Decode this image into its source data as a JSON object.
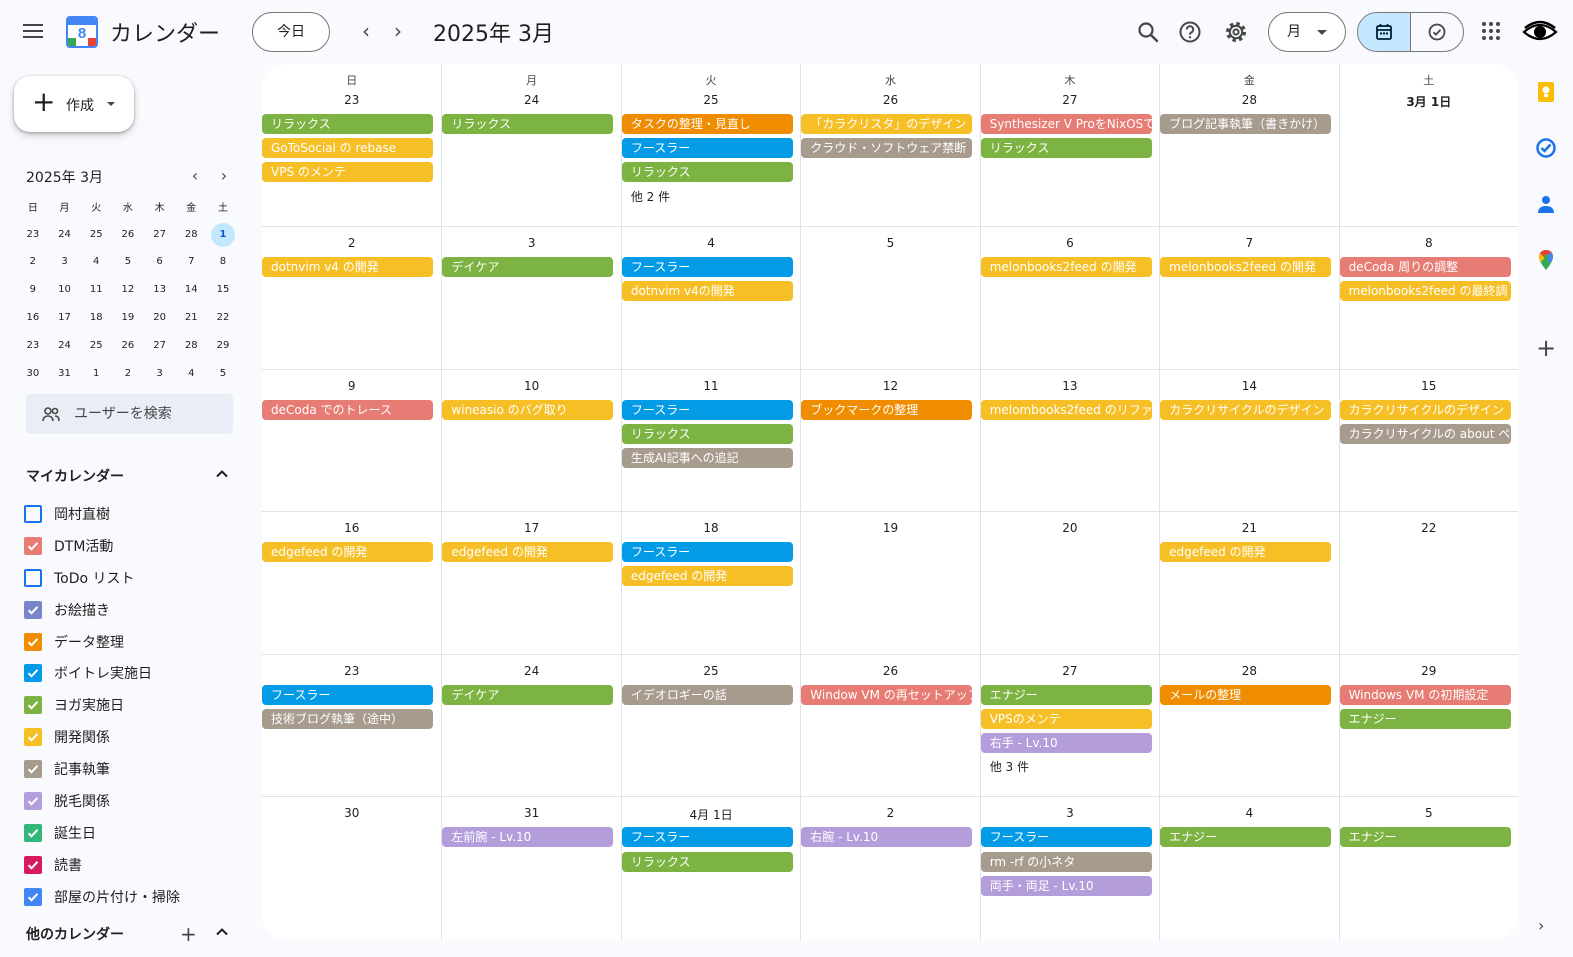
{
  "app": {
    "title": "カレンダー",
    "logo_number": "8"
  },
  "header": {
    "today_label": "今日",
    "month_title": "2025年 3月",
    "view_label": "月"
  },
  "sidebar": {
    "create_label": "作成",
    "mini_title": "2025年 3月",
    "mini_weekdays": [
      "日",
      "月",
      "火",
      "水",
      "木",
      "金",
      "土"
    ],
    "mini_weeks": [
      [
        "23",
        "24",
        "25",
        "26",
        "27",
        "28",
        "1"
      ],
      [
        "2",
        "3",
        "4",
        "5",
        "6",
        "7",
        "8"
      ],
      [
        "9",
        "10",
        "11",
        "12",
        "13",
        "14",
        "15"
      ],
      [
        "16",
        "17",
        "18",
        "19",
        "20",
        "21",
        "22"
      ],
      [
        "23",
        "24",
        "25",
        "26",
        "27",
        "28",
        "29"
      ],
      [
        "30",
        "31",
        "1",
        "2",
        "3",
        "4",
        "5"
      ]
    ],
    "mini_today": "1",
    "search_users": "ユーザーを検索",
    "my_calendars_title": "マイカレンダー",
    "my_calendars": [
      {
        "label": "岡村直樹",
        "color": "#1a73e8",
        "checked": false
      },
      {
        "label": "DTM活動",
        "color": "#e67c73",
        "checked": true
      },
      {
        "label": "ToDo リスト",
        "color": "#1a73e8",
        "checked": false
      },
      {
        "label": "お絵描き",
        "color": "#7986cb",
        "checked": true
      },
      {
        "label": "データ整理",
        "color": "#ef8c00",
        "checked": true
      },
      {
        "label": "ボイトレ実施日",
        "color": "#039be5",
        "checked": true
      },
      {
        "label": "ヨガ実施日",
        "color": "#7cb342",
        "checked": true
      },
      {
        "label": "開発関係",
        "color": "#f6bf26",
        "checked": true
      },
      {
        "label": "記事執筆",
        "color": "#a79b8e",
        "checked": true
      },
      {
        "label": "脱毛関係",
        "color": "#b39ddb",
        "checked": true
      },
      {
        "label": "誕生日",
        "color": "#33b679",
        "checked": true
      },
      {
        "label": "読書",
        "color": "#d81b60",
        "checked": true
      },
      {
        "label": "部屋の片付け・掃除",
        "color": "#4285f4",
        "checked": true
      }
    ],
    "other_calendars_title": "他のカレンダー"
  },
  "colors": {
    "green": "#7cb342",
    "yellow": "#f6bf26",
    "orange": "#ef8c00",
    "blue": "#039be5",
    "taupe": "#a79b8e",
    "flamingo": "#e67c73",
    "lavender": "#b39ddb"
  },
  "weekdays": [
    "日",
    "月",
    "火",
    "水",
    "木",
    "金",
    "土"
  ],
  "weeks": [
    [
      {
        "date": "23",
        "events": [
          {
            "t": "リラックス",
            "c": "green"
          },
          {
            "t": "GoToSocial の rebase",
            "c": "yellow"
          },
          {
            "t": "VPS のメンテ",
            "c": "yellow"
          }
        ]
      },
      {
        "date": "24",
        "events": [
          {
            "t": "リラックス",
            "c": "green"
          }
        ]
      },
      {
        "date": "25",
        "events": [
          {
            "t": "タスクの整理・見直し",
            "c": "orange"
          },
          {
            "t": "フースラー",
            "c": "blue"
          },
          {
            "t": "リラックス",
            "c": "green"
          }
        ],
        "more": "他 2 件"
      },
      {
        "date": "26",
        "events": [
          {
            "t": "「カラクリスタ」のデザイン",
            "c": "yellow"
          },
          {
            "t": "クラウド・ソフトウェア禁断",
            "c": "taupe"
          }
        ]
      },
      {
        "date": "27",
        "events": [
          {
            "t": "Synthesizer V ProをNixOSで",
            "c": "flamingo"
          },
          {
            "t": "リラックス",
            "c": "green"
          }
        ]
      },
      {
        "date": "28",
        "events": [
          {
            "t": "ブログ記事執筆（書きかけ）",
            "c": "taupe"
          }
        ]
      },
      {
        "date": "3月 1日",
        "bold": true,
        "events": []
      }
    ],
    [
      {
        "date": "2",
        "events": [
          {
            "t": "dotnvim v4 の開発",
            "c": "yellow"
          }
        ]
      },
      {
        "date": "3",
        "events": [
          {
            "t": "デイケア",
            "c": "green"
          }
        ]
      },
      {
        "date": "4",
        "events": [
          {
            "t": "フースラー",
            "c": "blue"
          },
          {
            "t": "dotnvim v4の開発",
            "c": "yellow"
          }
        ]
      },
      {
        "date": "5",
        "events": []
      },
      {
        "date": "6",
        "events": [
          {
            "t": "melonbooks2feed の開発",
            "c": "yellow"
          }
        ]
      },
      {
        "date": "7",
        "events": [
          {
            "t": "melonbooks2feed の開発",
            "c": "yellow"
          }
        ]
      },
      {
        "date": "8",
        "events": [
          {
            "t": "deCoda 周りの調整",
            "c": "flamingo"
          },
          {
            "t": "melonbooks2feed の最終調",
            "c": "yellow"
          }
        ]
      }
    ],
    [
      {
        "date": "9",
        "events": [
          {
            "t": "deCoda でのトレース",
            "c": "flamingo"
          }
        ]
      },
      {
        "date": "10",
        "events": [
          {
            "t": "wineasio のバグ取り",
            "c": "yellow"
          }
        ]
      },
      {
        "date": "11",
        "events": [
          {
            "t": "フースラー",
            "c": "blue"
          },
          {
            "t": "リラックス",
            "c": "green"
          },
          {
            "t": "生成AI記事への追記",
            "c": "taupe"
          }
        ]
      },
      {
        "date": "12",
        "events": [
          {
            "t": "ブックマークの整理",
            "c": "orange"
          }
        ]
      },
      {
        "date": "13",
        "events": [
          {
            "t": "melombooks2feed のリファ",
            "c": "yellow"
          }
        ]
      },
      {
        "date": "14",
        "events": [
          {
            "t": "カラクリサイクルのデザイン",
            "c": "yellow"
          }
        ]
      },
      {
        "date": "15",
        "events": [
          {
            "t": "カラクリサイクルのデザイン",
            "c": "yellow"
          },
          {
            "t": "カラクリサイクルの about ペ",
            "c": "taupe"
          }
        ]
      }
    ],
    [
      {
        "date": "16",
        "events": [
          {
            "t": "edgefeed の開発",
            "c": "yellow"
          }
        ]
      },
      {
        "date": "17",
        "events": [
          {
            "t": "edgefeed の開発",
            "c": "yellow"
          }
        ]
      },
      {
        "date": "18",
        "events": [
          {
            "t": "フースラー",
            "c": "blue"
          },
          {
            "t": "edgefeed の開発",
            "c": "yellow"
          }
        ]
      },
      {
        "date": "19",
        "events": []
      },
      {
        "date": "20",
        "events": []
      },
      {
        "date": "21",
        "events": [
          {
            "t": "edgefeed の開発",
            "c": "yellow"
          }
        ]
      },
      {
        "date": "22",
        "events": []
      }
    ],
    [
      {
        "date": "23",
        "events": [
          {
            "t": "フースラー",
            "c": "blue"
          },
          {
            "t": "技術ブログ執筆（途中）",
            "c": "taupe"
          }
        ]
      },
      {
        "date": "24",
        "events": [
          {
            "t": "デイケア",
            "c": "green"
          }
        ]
      },
      {
        "date": "25",
        "events": [
          {
            "t": "イデオロギーの話",
            "c": "taupe"
          }
        ]
      },
      {
        "date": "26",
        "events": [
          {
            "t": "Window VM の再セットアップ",
            "c": "flamingo"
          }
        ]
      },
      {
        "date": "27",
        "events": [
          {
            "t": "エナジー",
            "c": "green"
          },
          {
            "t": "VPSのメンテ",
            "c": "yellow"
          },
          {
            "t": "右手 - Lv.10",
            "c": "lavender"
          }
        ],
        "more": "他 3 件"
      },
      {
        "date": "28",
        "events": [
          {
            "t": "メールの整理",
            "c": "orange"
          }
        ]
      },
      {
        "date": "29",
        "events": [
          {
            "t": "Windows VM の初期設定",
            "c": "flamingo"
          },
          {
            "t": "エナジー",
            "c": "green"
          }
        ]
      }
    ],
    [
      {
        "date": "30",
        "events": []
      },
      {
        "date": "31",
        "events": [
          {
            "t": "左前腕 - Lv.10",
            "c": "lavender"
          }
        ]
      },
      {
        "date": "4月 1日",
        "events": [
          {
            "t": "フースラー",
            "c": "blue"
          },
          {
            "t": "リラックス",
            "c": "green"
          }
        ]
      },
      {
        "date": "2",
        "events": [
          {
            "t": "右腕 - Lv.10",
            "c": "lavender"
          }
        ]
      },
      {
        "date": "3",
        "events": [
          {
            "t": "フースラー",
            "c": "blue"
          },
          {
            "t": "rm -rf の小ネタ",
            "c": "taupe"
          },
          {
            "t": "両手・両足 - Lv.10",
            "c": "lavender"
          }
        ]
      },
      {
        "date": "4",
        "events": [
          {
            "t": "エナジー",
            "c": "green"
          }
        ]
      },
      {
        "date": "5",
        "events": [
          {
            "t": "エナジー",
            "c": "green"
          }
        ]
      }
    ]
  ]
}
